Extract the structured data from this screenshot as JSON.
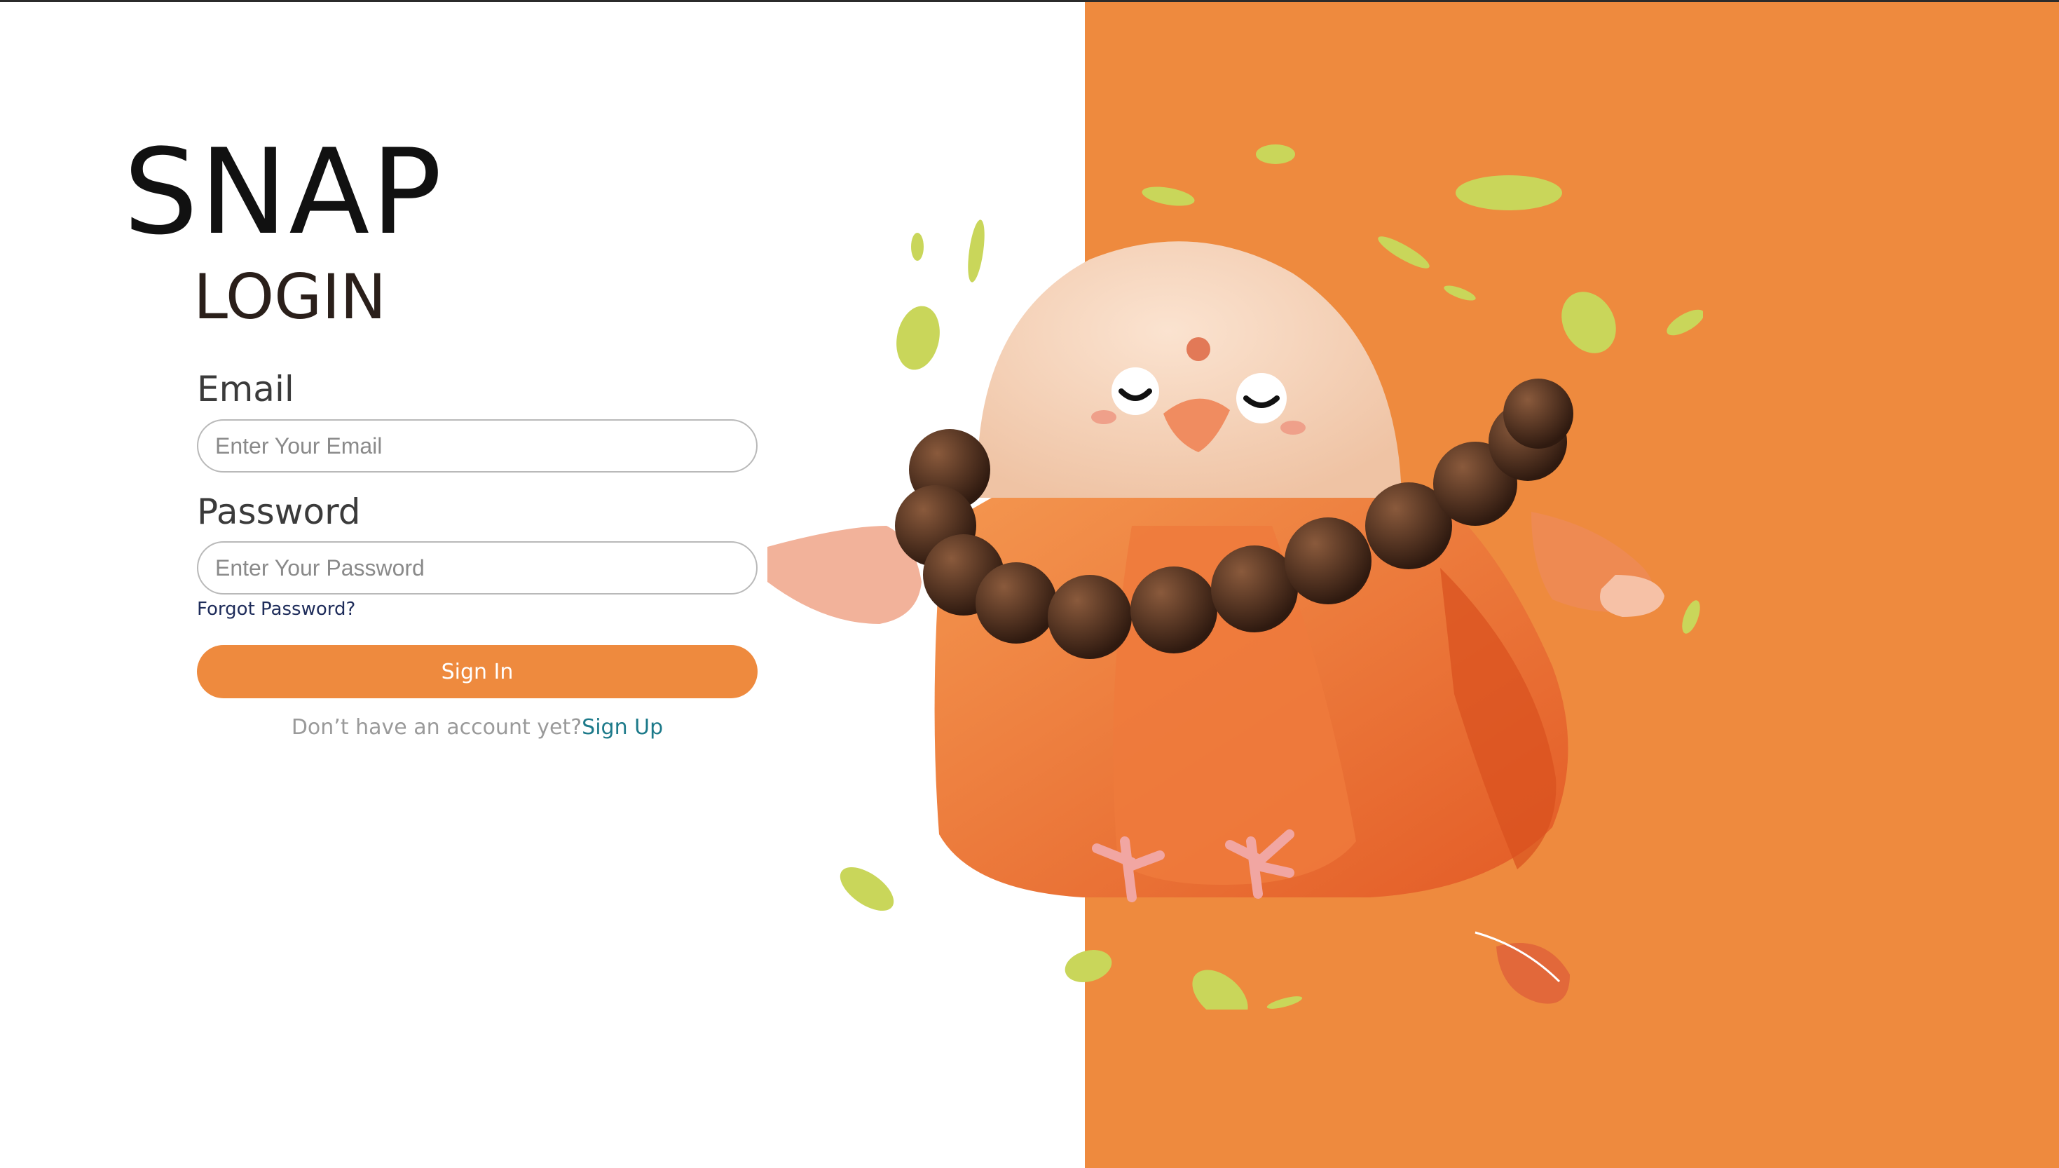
{
  "brand": {
    "name": "SNAP"
  },
  "login": {
    "title": "LOGIN",
    "email_label": "Email",
    "email_placeholder": "Enter Your Email",
    "email_value": "",
    "password_label": "Password",
    "password_placeholder": "Enter Your Password",
    "password_value": "",
    "forgot_password": "Forgot Password?",
    "sign_in_label": "Sign In",
    "no_account_text": "Don’t have an account yet?",
    "sign_up_link": "Sign Up"
  },
  "hero": {
    "illustration": "monk-bird-mascot",
    "background_color": "#EE8A3E"
  },
  "colors": {
    "accent": "#EE8A3E",
    "link": "#1d7a8a",
    "forgot_link": "#1e2c5a"
  }
}
